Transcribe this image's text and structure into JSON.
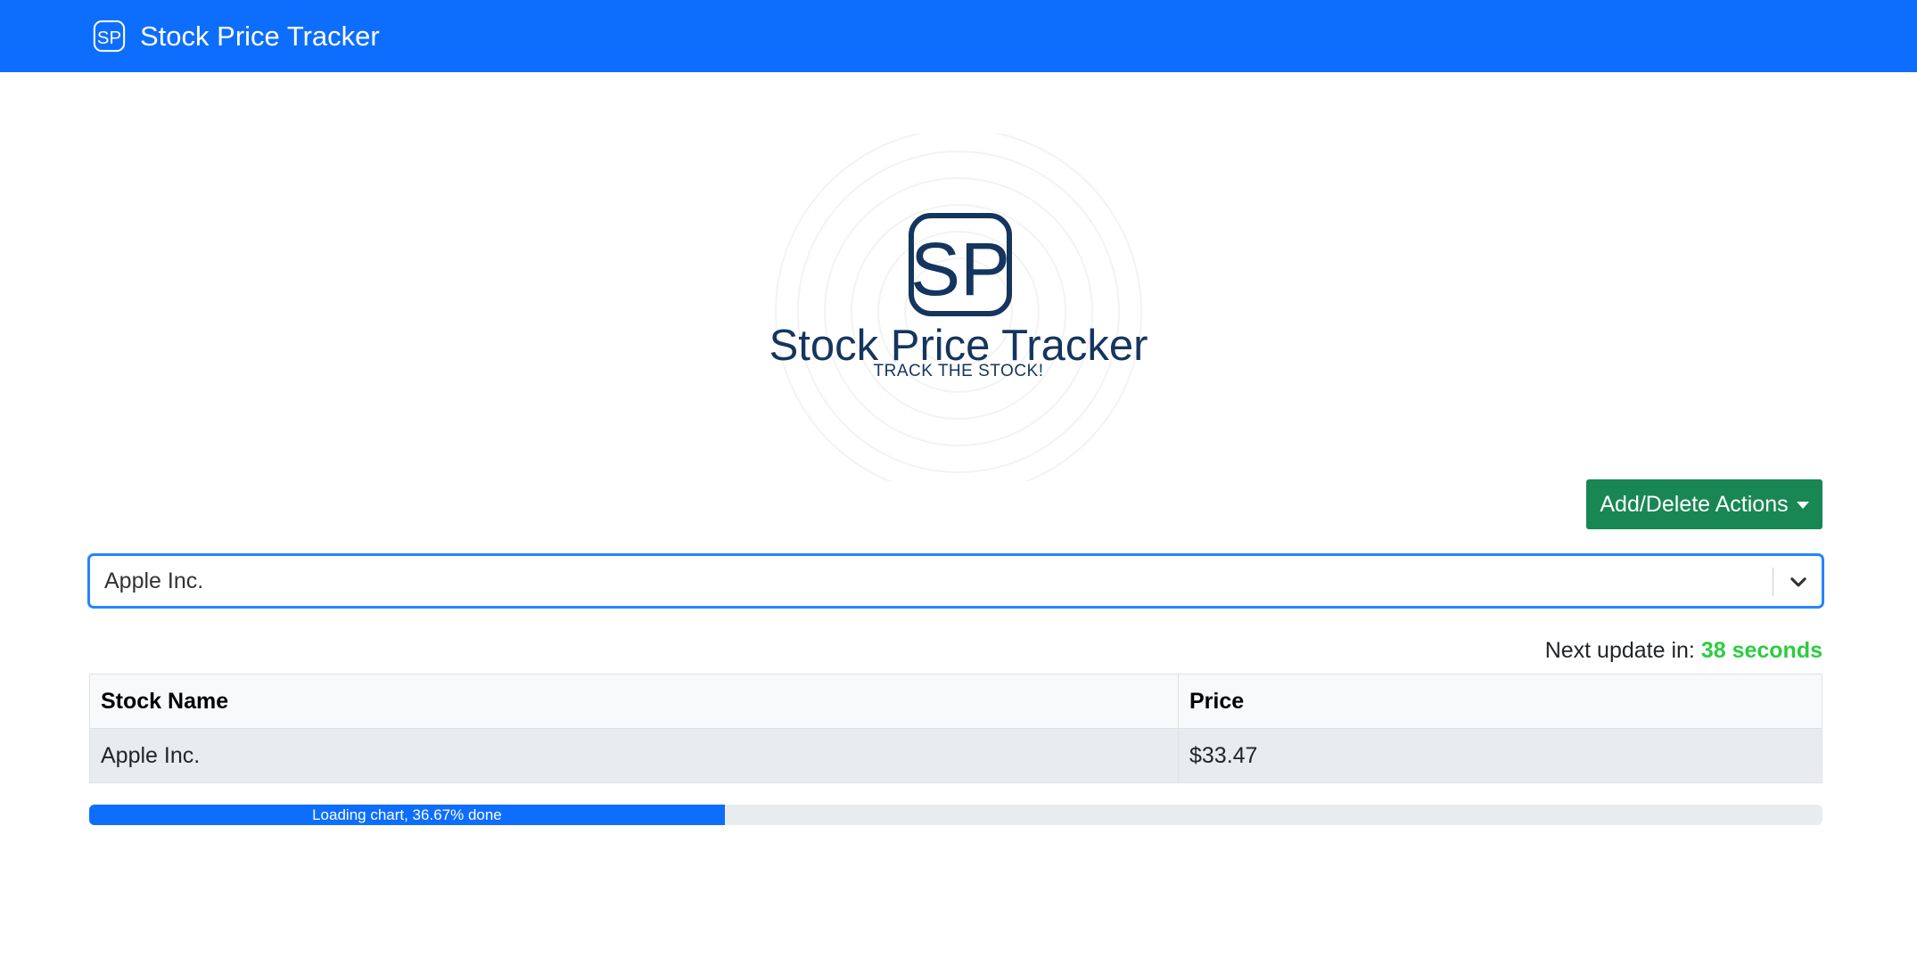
{
  "navbar": {
    "logo_letters": "SP",
    "brand": "Stock Price Tracker"
  },
  "hero": {
    "logo_letters": "SP",
    "title": "Stock Price Tracker",
    "subtitle": "TRACK THE STOCK!"
  },
  "actions": {
    "label": "Add/Delete Actions",
    "color": "#198754"
  },
  "stock_select": {
    "selected": "Apple Inc.",
    "icon": "chevron-down-icon"
  },
  "update": {
    "prefix": "Next update in:",
    "countdown": "38 seconds",
    "countdown_color": "#2ecc40"
  },
  "table": {
    "headers": [
      "Stock Name",
      "Price"
    ],
    "rows": [
      [
        "Apple Inc.",
        "$33.47"
      ]
    ]
  },
  "progress": {
    "label": "Loading chart, 36.67% done",
    "percent": 36.67,
    "color": "#0d6efd"
  },
  "colors": {
    "primary": "#0d6efd",
    "logo_navy": "#14355e",
    "success": "#198754"
  }
}
